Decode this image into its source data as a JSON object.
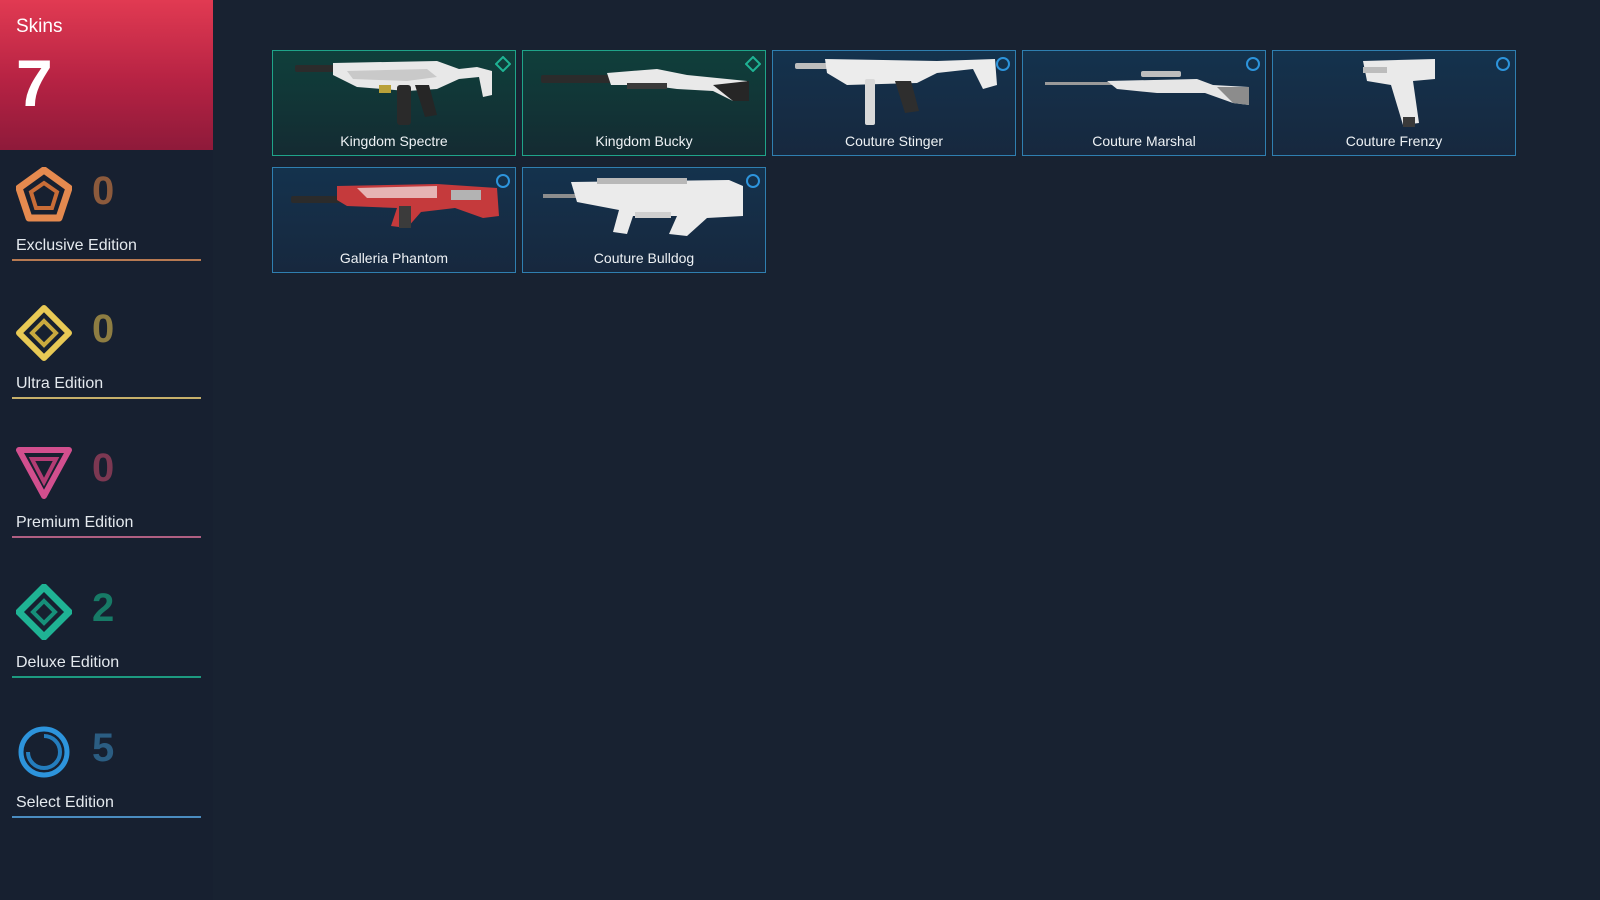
{
  "skins": {
    "title": "Skins",
    "count": "7"
  },
  "tiers": [
    {
      "key": "exclusive",
      "label": "Exclusive Edition",
      "count": "0",
      "color": "#e58a4f",
      "count_color": "#8c5a3c",
      "icon": "exclusive-edition-icon"
    },
    {
      "key": "ultra",
      "label": "Ultra Edition",
      "count": "0",
      "color": "#e8c955",
      "count_color": "#8e7d42",
      "icon": "ultra-edition-icon"
    },
    {
      "key": "premium",
      "label": "Premium Edition",
      "count": "0",
      "color": "#d24f8e",
      "count_color": "#7c3852",
      "icon": "premium-edition-icon"
    },
    {
      "key": "deluxe",
      "label": "Deluxe Edition",
      "count": "2",
      "color": "#1fb394",
      "count_color": "#177a66",
      "icon": "deluxe-edition-icon"
    },
    {
      "key": "select",
      "label": "Select Edition",
      "count": "5",
      "color": "#2d94dc",
      "count_color": "#2b5d82",
      "icon": "select-edition-icon"
    }
  ],
  "cards": [
    {
      "name": "Kingdom Spectre",
      "tier": "deluxe",
      "weapon_icon": "spectre-weapon-icon"
    },
    {
      "name": "Kingdom Bucky",
      "tier": "deluxe",
      "weapon_icon": "bucky-weapon-icon"
    },
    {
      "name": "Couture Stinger",
      "tier": "select",
      "weapon_icon": "stinger-weapon-icon"
    },
    {
      "name": "Couture Marshal",
      "tier": "select",
      "weapon_icon": "marshal-weapon-icon"
    },
    {
      "name": "Couture Frenzy",
      "tier": "select",
      "weapon_icon": "frenzy-weapon-icon"
    },
    {
      "name": "Galleria Phantom",
      "tier": "select",
      "weapon_icon": "phantom-weapon-icon"
    },
    {
      "name": "Couture Bulldog",
      "tier": "select",
      "weapon_icon": "bulldog-weapon-icon"
    }
  ]
}
